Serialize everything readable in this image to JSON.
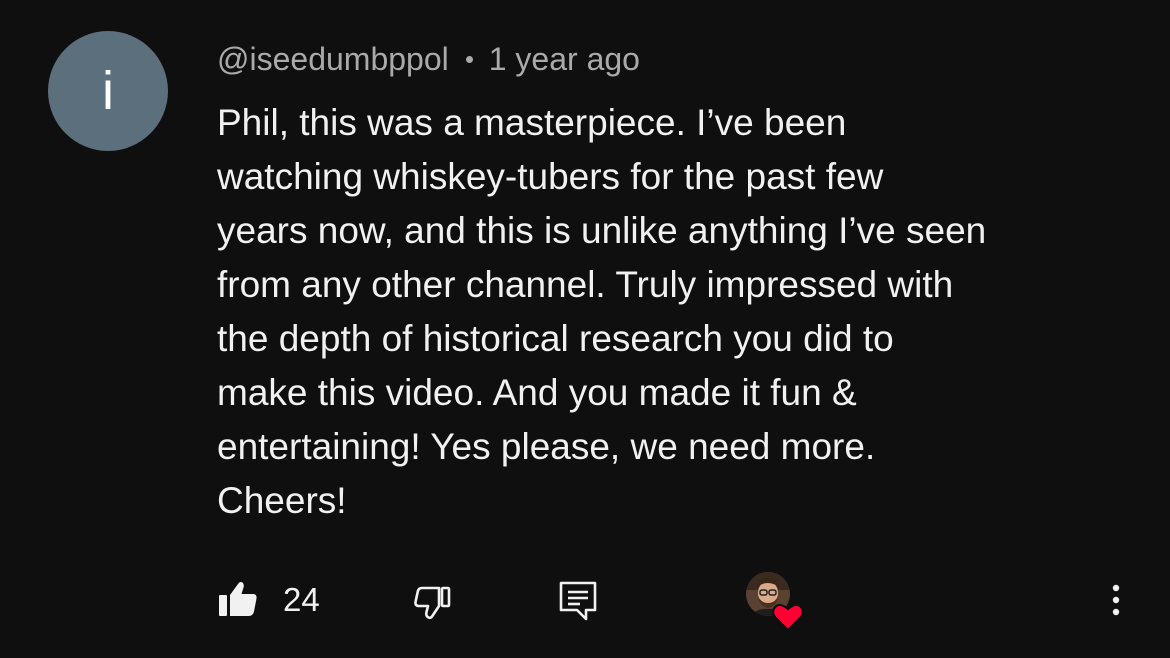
{
  "comment": {
    "avatar_letter": "i",
    "avatar_color": "#5b6f7d",
    "author": "@iseedumbppol",
    "timestamp": "1 year ago",
    "text": "Phil, this was a masterpiece. I’ve been\nwatching whiskey-tubers for the past few\nyears now, and this is unlike anything I’ve seen\nfrom any other channel. Truly impressed with\nthe depth of historical research you did to\nmake this video. And you made it fun &\nentertaining! Yes please, we need more.\nCheers!"
  },
  "actions": {
    "like_icon": "thumbs-up-filled-icon",
    "like_count": "24",
    "dislike_icon": "thumbs-down-outline-icon",
    "reply_icon": "comment-reply-icon",
    "creator_heart_icon": "heart-icon",
    "heart_color": "#ff0033",
    "more_icon": "vertical-dots-icon"
  }
}
